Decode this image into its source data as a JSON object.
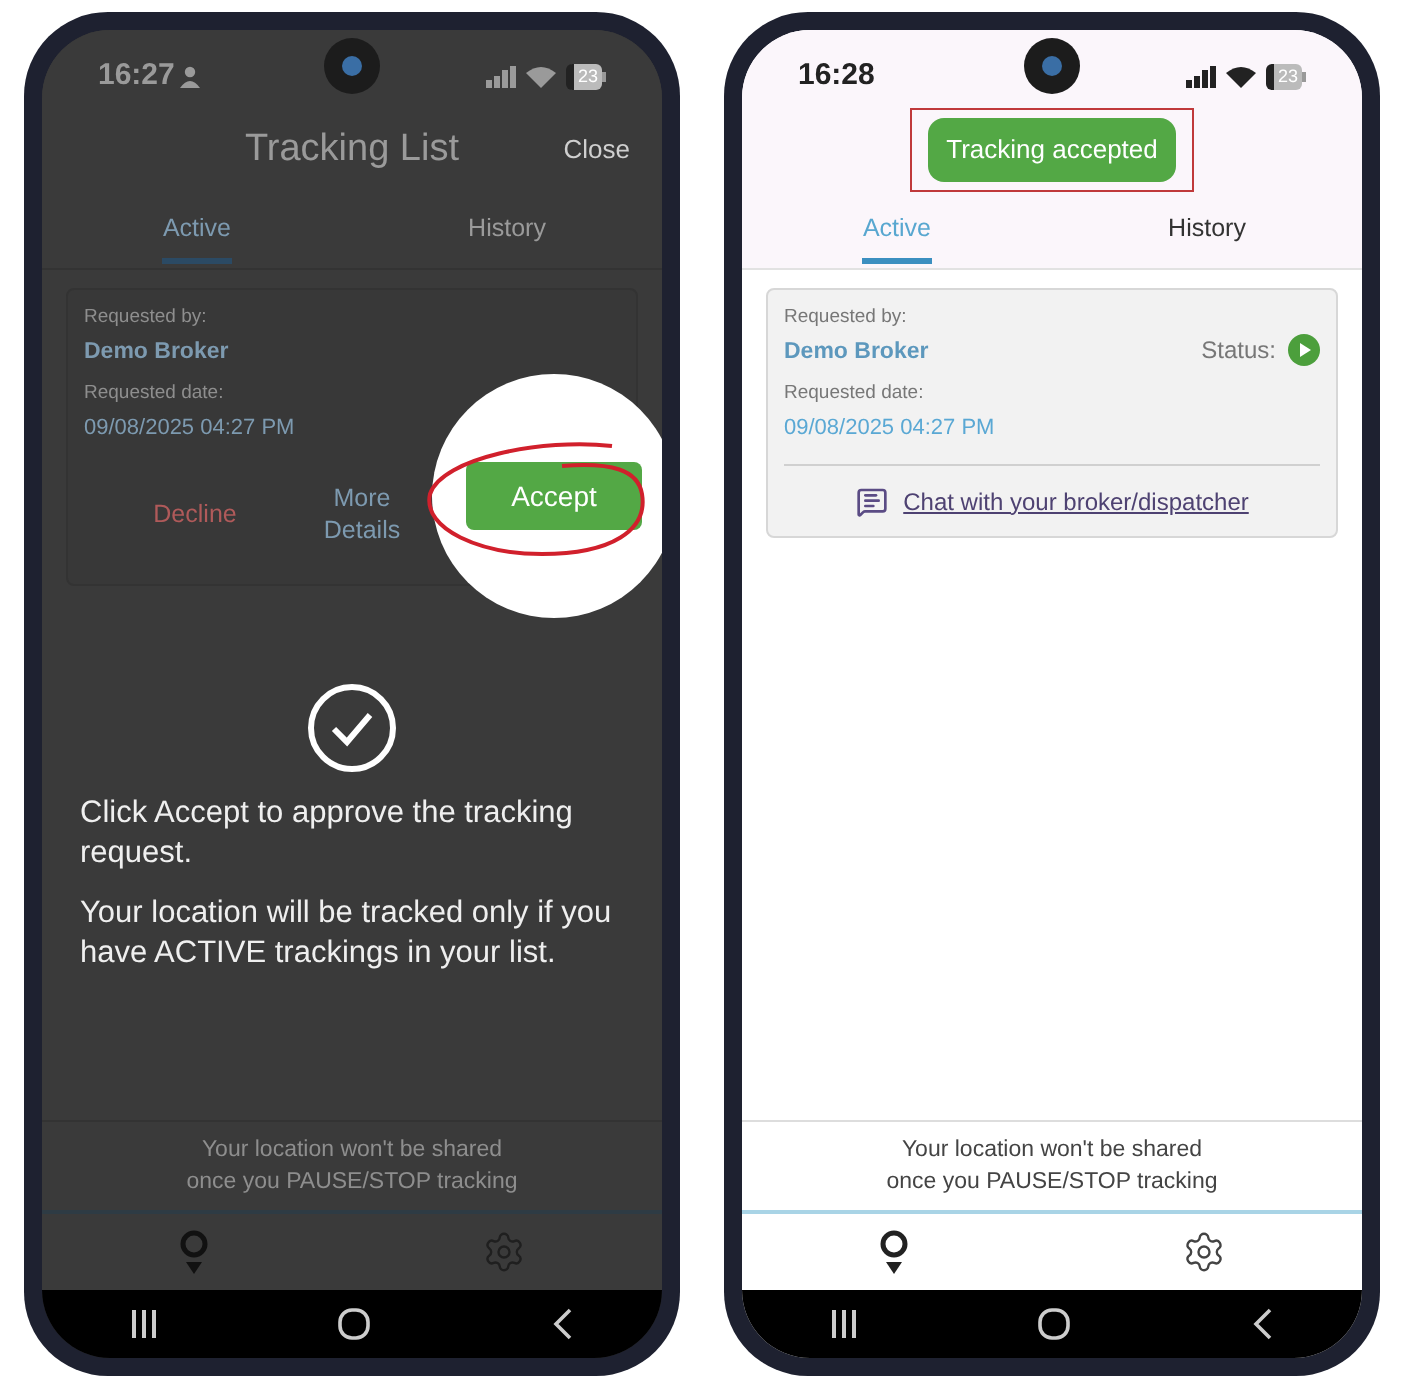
{
  "phones": [
    {
      "dimmed": true,
      "status_bar": {
        "time": "16:27",
        "person_icon": true,
        "battery": "23"
      },
      "title": "Tracking List",
      "close": "Close",
      "tabs": [
        {
          "label": "Active",
          "selected": true
        },
        {
          "label": "History",
          "selected": false
        }
      ],
      "card": {
        "requested_by_label": "Requested by:",
        "requested_by": "Demo Broker",
        "date_label": "Requested date:",
        "date": "09/08/2025 04:27 PM",
        "actions": [
          {
            "label": "Decline",
            "kind": "decline",
            "highlighted": false
          },
          {
            "label": "More Details",
            "kind": "details",
            "highlighted": false
          },
          {
            "label": "Accept",
            "kind": "accept",
            "highlighted": true
          }
        ]
      },
      "overlay": {
        "paragraphs": [
          "Click Accept to approve the tracking request.",
          "Your location will be tracked only if you have ACTIVE trackings in your list."
        ]
      },
      "notice_lines": [
        "Your location won't be shared",
        "once you PAUSE/STOP tracking"
      ]
    },
    {
      "dimmed": false,
      "status_bar": {
        "time": "16:28",
        "person_icon": false,
        "battery": "23"
      },
      "toast": "Tracking accepted",
      "tabs": [
        {
          "label": "Active",
          "selected": true
        },
        {
          "label": "History",
          "selected": false
        }
      ],
      "card": {
        "requested_by_label": "Requested by:",
        "requested_by": "Demo Broker",
        "date_label": "Requested date:",
        "date": "09/08/2025 04:27 PM",
        "status": {
          "label": "Status:",
          "active": true
        },
        "chat_link": "Chat with your broker/dispatcher"
      },
      "notice_lines": [
        "Your location won't be shared",
        "once you PAUSE/STOP tracking"
      ]
    }
  ]
}
